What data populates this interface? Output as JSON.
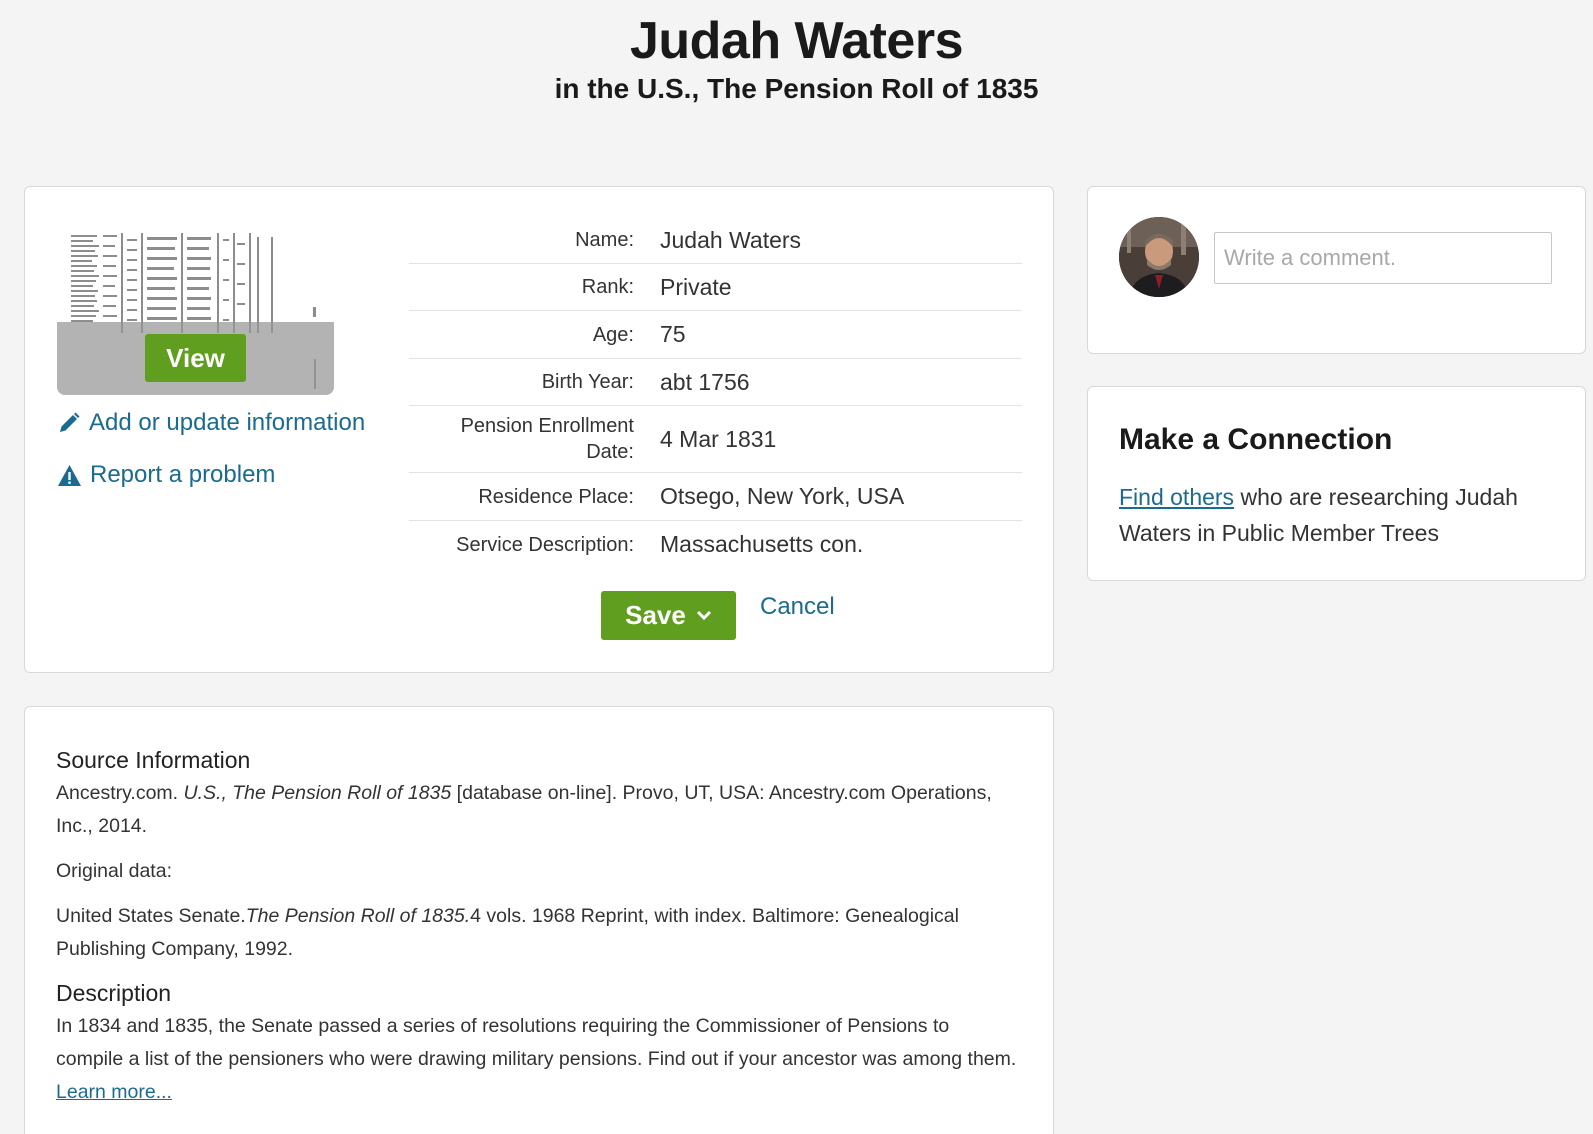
{
  "header": {
    "person_name": "Judah Waters",
    "collection_title": "in the U.S., The Pension Roll of 1835"
  },
  "record": {
    "view_label": "View",
    "add_update_label": "Add or update information",
    "report_problem_label": "Report a problem",
    "fields": [
      {
        "label": "Name:",
        "value": "Judah Waters"
      },
      {
        "label": "Rank:",
        "value": "Private"
      },
      {
        "label": "Age:",
        "value": "75"
      },
      {
        "label": "Birth Year:",
        "value": "abt 1756"
      },
      {
        "label": "Pension Enrollment Date:",
        "value": "4 Mar 1831"
      },
      {
        "label": "Residence Place:",
        "value": "Otsego, New York, USA"
      },
      {
        "label": "Service Description:",
        "value": "Massachusetts con."
      }
    ],
    "save_label": "Save",
    "cancel_label": "Cancel"
  },
  "comment": {
    "placeholder": "Write a comment."
  },
  "connection": {
    "title": "Make a Connection",
    "link_text": "Find others",
    "text": " who are researching Judah Waters in Public Member Trees"
  },
  "source": {
    "heading": "Source Information",
    "citation_prefix": "Ancestry.com. ",
    "citation_title": "U.S., The Pension Roll of 1835",
    "citation_suffix": " [database on-line]. Provo, UT, USA: Ancestry.com Operations, Inc., 2014.",
    "original_data_label": "Original data:",
    "original_prefix": "United States Senate.",
    "original_title": "The Pension Roll of 1835.",
    "original_suffix": "4 vols. 1968 Reprint, with index. Baltimore: Genealogical Publishing Company, 1992.",
    "description_heading": "Description",
    "description_text": "In 1834 and 1835, the Senate passed a series of resolutions requiring the Commissioner of Pensions to compile a list of the pensioners who were drawing military pensions. Find out if your ancestor was among them. ",
    "learn_more": "Learn more..."
  },
  "colors": {
    "accent_green": "#5f9e1f",
    "link_blue": "#1a6b8f",
    "page_background": "#f4f4f4"
  },
  "icons": [
    "pencil-icon",
    "warning-icon",
    "chevron-down-icon"
  ]
}
